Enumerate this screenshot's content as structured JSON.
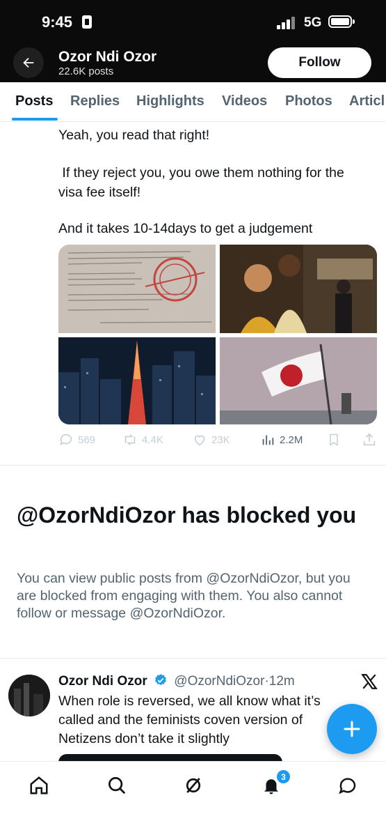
{
  "status_bar": {
    "time": "9:45",
    "network": "5G"
  },
  "header": {
    "name": "Ozor Ndi Ozor",
    "posts_count": "22.6K posts",
    "follow_label": "Follow"
  },
  "tabs": [
    "Posts",
    "Replies",
    "Highlights",
    "Videos",
    "Photos",
    "Articl"
  ],
  "tweet1": {
    "lines": [
      "Yeah, you read that right!",
      " If they reject you, you owe them nothing for the visa fee itself!",
      "And it takes 10-14days to get a judgement"
    ],
    "actions": {
      "replies": "569",
      "reposts": "4.4K",
      "likes": "23K",
      "views": "2.2M"
    }
  },
  "blocked_notice": {
    "title": "@OzorNdiOzor has blocked you",
    "body": "You can view public posts from @OzorNdiOzor, but you are blocked from engaging with them. You also cannot follow or message @OzorNdiOzor."
  },
  "tweet2": {
    "name": "Ozor Ndi Ozor",
    "handle": "@OzorNdiOzor",
    "separator": "·",
    "time": "12m",
    "text": "When role is reversed, we all know what it’s called and the feminists coven version of Netizens don’t take it slightly"
  },
  "bottom_nav": {
    "notifications_badge": "3"
  },
  "icons": [
    "back-arrow-icon",
    "home-icon",
    "search-icon",
    "grok-icon",
    "bell-icon",
    "messages-icon",
    "reply-icon",
    "repost-icon",
    "like-icon",
    "views-icon",
    "bookmark-icon",
    "share-icon",
    "verified-badge-icon",
    "x-logo-icon",
    "plus-icon"
  ],
  "colors": {
    "accent": "#1d9bf0",
    "text": "#0f1419",
    "muted": "#536471"
  }
}
